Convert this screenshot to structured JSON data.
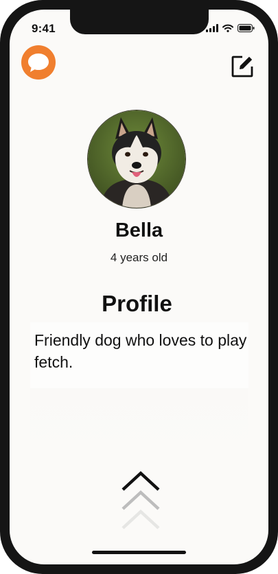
{
  "status_bar": {
    "time": "9:41",
    "icons": [
      "cellular-signal-icon",
      "wifi-icon",
      "battery-icon"
    ]
  },
  "header": {
    "logo_icon": "chat-bubble-icon",
    "edit_icon": "edit-icon"
  },
  "pet": {
    "name": "Bella",
    "age": "4 years old"
  },
  "profile": {
    "heading": "Profile",
    "bio": "Friendly dog who loves to play fetch."
  },
  "footer": {
    "swipe_icon": "chevron-up-icon"
  },
  "colors": {
    "accent": "#f07f2f",
    "background": "#fbfaf8",
    "text": "#111111"
  }
}
